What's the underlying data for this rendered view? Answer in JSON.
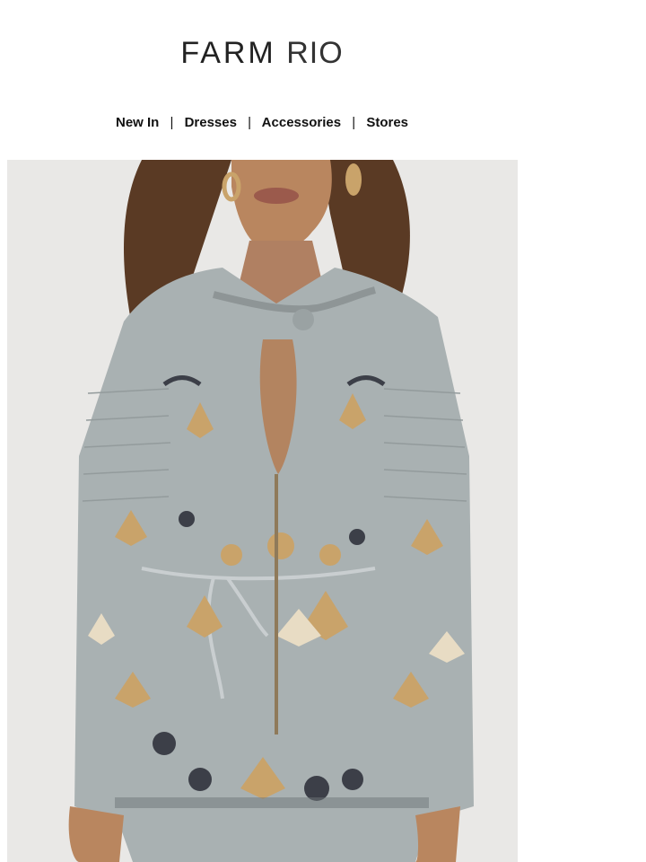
{
  "brand": {
    "logo_text_1": "FARM",
    "logo_text_2": "RIO"
  },
  "nav": {
    "items": [
      {
        "label": "New In"
      },
      {
        "label": "Dresses"
      },
      {
        "label": "Accessories"
      },
      {
        "label": "Stores"
      }
    ],
    "separator": "|"
  },
  "hero": {
    "alt": "Model wearing grey floral printed long-sleeve blouse",
    "colors": {
      "background": "#e9e8e6",
      "fabric": "#a9b1b2",
      "print_gold": "#c9a36a",
      "print_dark": "#3c3f48",
      "skin": "#b9865f",
      "hair": "#5a3a24"
    }
  }
}
